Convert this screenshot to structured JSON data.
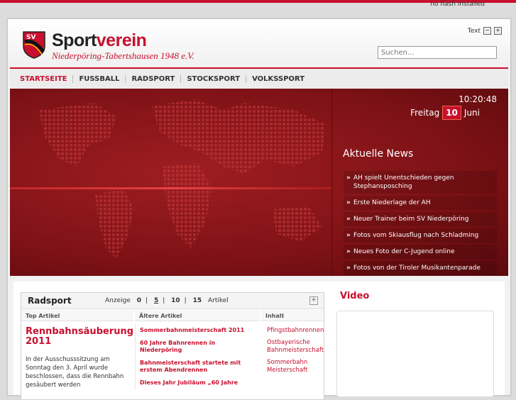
{
  "flash_notice": "no flash installed",
  "header": {
    "shield_text": "SV",
    "brand_part1": "Sport",
    "brand_part2": "verein",
    "subtitle": "Niederpöring-Tabertshausen 1948 e.V.",
    "text_size_label": "Text",
    "text_minus": "−",
    "text_plus": "+",
    "search_placeholder": "Suchen..."
  },
  "nav": {
    "items": [
      "STARTSEITE",
      "FUSSBALL",
      "RADSPORT",
      "STOCKSPORT",
      "VOLKSSPORT"
    ]
  },
  "hero": {
    "time": "10:20:48",
    "weekday": "Freitag",
    "day": "10",
    "month": "Juni",
    "news_title": "Aktuelle News",
    "news": [
      "AH spielt Unentschieden gegen Stephansposching",
      "Erste Niederlage der AH",
      "Neuer Trainer beim SV Niederpöring",
      "Fotos vom Skiausflug nach Schladming",
      "Neues Foto der C-Jugend online",
      "Fotos von der Tiroler Musikantenparade"
    ]
  },
  "radsport": {
    "title": "Radsport",
    "anzeige_label": "Anzeige",
    "counts": [
      "0",
      "5",
      "10",
      "15"
    ],
    "sep": "|",
    "artikel_label": "Artikel",
    "plus": "+",
    "col_top": "Top Artikel",
    "col_alt": "Ältere Artikel",
    "col_inhalt": "Inhalt",
    "top_title": "Rennbahnsäuberung 2011",
    "top_body": "In der Ausschusssitzung am Sonntag den 3. April wurde beschlossen, dass die Rennbahn gesäubert werden",
    "older": [
      "Sommerbahnmeisterschaft 2011",
      "60 Jahre Bahnrennen in Niederpöring",
      "Bahnmeisterschaft startete mit erstem Abendrennen",
      "Dieses Jahr Jubiläum „60 Jahre"
    ],
    "inhalt": [
      "Pfingstbahnrennen",
      "Ostbayerische Bahnmeisterschaft",
      "Sommerbahn Meisterschaft"
    ]
  },
  "video": {
    "title": "Video"
  },
  "colors": {
    "accent": "#c8102e",
    "hero_bg": "#8b1519"
  }
}
